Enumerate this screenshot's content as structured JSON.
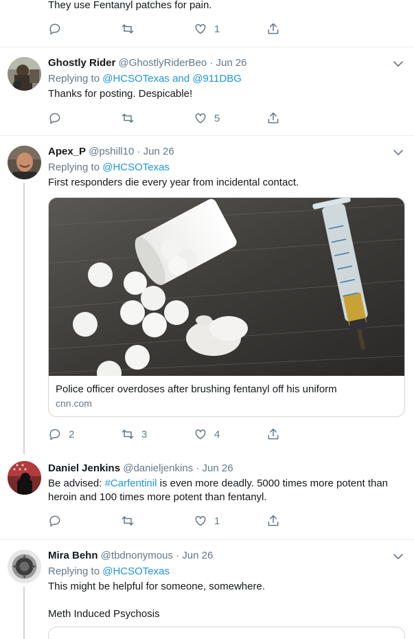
{
  "tweets": [
    {
      "text": "They use Fentanyl patches for pain.",
      "likes": "1"
    },
    {
      "name": "Ghostly Rider",
      "meta": "@GhostlyRiderBeo · Jun 26",
      "replying_prefix": "Replying to ",
      "replying_to": "@HCSOTexas and @911DBG",
      "text": "Thanks for posting. Despicable!",
      "likes": "5"
    },
    {
      "name": "Apex_P",
      "meta": "@pshill10 · Jun 26",
      "replying_prefix": "Replying to ",
      "replying_to": "@HCSOTexas",
      "text": "First responders die every year from incidental contact.",
      "card_title": "Police officer overdoses after brushing fentanyl off his uniform",
      "card_domain": "cnn.com",
      "replies": "2",
      "retweets": "3",
      "likes": "4"
    },
    {
      "name": "Daniel Jenkins",
      "meta": "@danieljenkins · Jun 26",
      "text_prefix": "Be advised: ",
      "hashtag": "#Carfentinil",
      "text_line1_rest": " is even more deadly. 5000 times more potent than",
      "text_line2": "heroin and 100 times more potent than fentanyl.",
      "likes": "1"
    },
    {
      "name": "Mira Behn",
      "meta": "@tbdnonymous · Jun 26",
      "replying_prefix": "Replying to ",
      "replying_to": "@HCSOTexas",
      "text": "This might be helpful for someone, somewhere.",
      "text2": "Meth Induced Psychosis"
    }
  ],
  "colors": {
    "link": "#1b95e0",
    "muted": "#657786",
    "divider": "#e6ecf0",
    "thread_line": "#ccd6dd"
  },
  "icons": [
    "reply-icon",
    "retweet-icon",
    "like-icon",
    "share-icon",
    "caret-down-icon"
  ]
}
